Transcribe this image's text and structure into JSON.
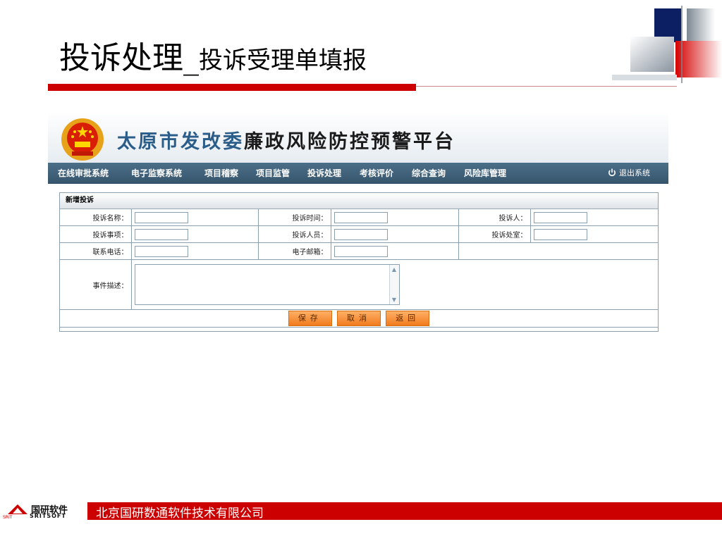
{
  "slide": {
    "title_main": "投诉处理_",
    "title_sub": "投诉受理单填报"
  },
  "app": {
    "title_part1": "太原市发改委",
    "title_part2": "廉政风险防控预警平台",
    "nav": [
      "在线审批系统",
      "电子监察系统",
      "项目稽察",
      "项目监管",
      "投诉处理",
      "考核评价",
      "综合查询",
      "风险库管理"
    ],
    "logout_label": "退出系统",
    "form": {
      "heading": "新增投诉",
      "fields": {
        "complaint_name": {
          "label": "投诉名称：",
          "value": ""
        },
        "complaint_time": {
          "label": "投诉时间：",
          "value": ""
        },
        "complainant": {
          "label": "投诉人：",
          "value": ""
        },
        "complaint_item": {
          "label": "投诉事项：",
          "value": ""
        },
        "complained_person": {
          "label": "投诉人员：",
          "value": ""
        },
        "complained_office": {
          "label": "投诉处室：",
          "value": ""
        },
        "phone": {
          "label": "联系电话：",
          "value": ""
        },
        "email": {
          "label": "电子邮箱：",
          "value": ""
        },
        "description": {
          "label": "事件描述：",
          "value": ""
        }
      },
      "buttons": {
        "save": "保存",
        "cancel": "取消",
        "back": "返回"
      }
    }
  },
  "footer": {
    "company": "北京国研数通软件技术有限公司",
    "logo_cn": "国研软件",
    "logo_en": "SRITSOFT",
    "logo_small": "SRIT"
  },
  "colors": {
    "accent_red": "#cc0000",
    "nav_blue": "#3f6077",
    "button_orange": "#f07a1e"
  }
}
